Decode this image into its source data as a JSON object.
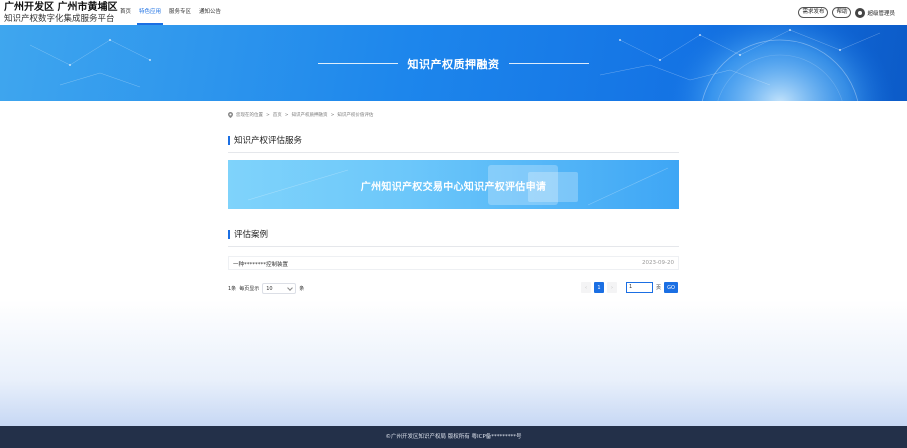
{
  "header": {
    "title": "广州开发区 广州市黄埔区",
    "subtitle": "知识产权数字化集成服务平台",
    "nav": [
      {
        "label": "首页"
      },
      {
        "label": "特色应用",
        "active": true
      },
      {
        "label": "服务专区"
      },
      {
        "label": "通知公告"
      }
    ],
    "demand_label": "需求发布",
    "help_label": "帮助",
    "user_label": "超级管理员"
  },
  "banner": {
    "title": "知识产权质押融资"
  },
  "breadcrumb": {
    "prefix": "您现在的位置",
    "items": [
      "首页",
      "知识产权质押融资",
      "知识产权价值评估"
    ]
  },
  "service_section": {
    "title": "知识产权评估服务",
    "apply_banner_text": "广州知识产权交易中心知识产权评估申请"
  },
  "cases_section": {
    "title": "评估案例",
    "items": [
      {
        "title": "一种********控制装置",
        "date": "2023-09-20"
      }
    ]
  },
  "pagination": {
    "total_text": "1条",
    "per_page_label": "每页显示",
    "page_size": "10",
    "unit": "条",
    "current_page": "1",
    "goto_value": "1",
    "page_unit": "页",
    "go_label": "GO"
  },
  "footer": {
    "text": "©广州开发区知识产权局 版权所有 粤ICP备*********号"
  },
  "colors": {
    "accent": "#1b6fe3",
    "footer_bg": "#233049"
  }
}
